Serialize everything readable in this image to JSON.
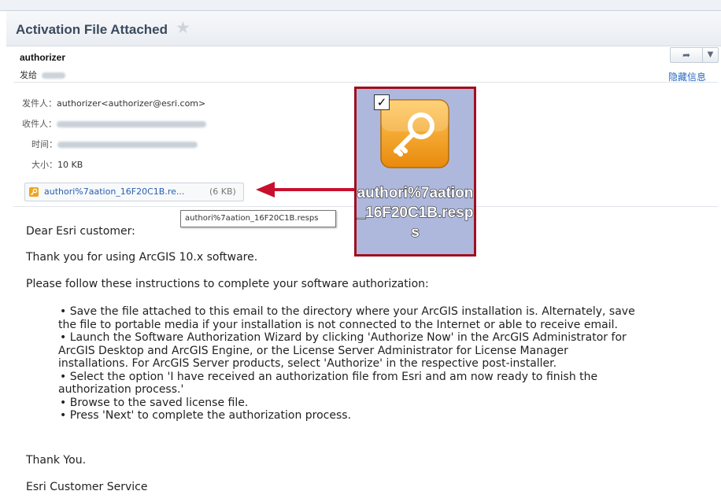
{
  "email": {
    "subject": "Activation File Attached",
    "sender_name": "authorizer",
    "to_label": "发给",
    "hide_details_label": "隐藏信息",
    "details": {
      "from_label": "发件人：",
      "from_value": "authorizer<authorizer@esri.com>",
      "to_label": "收件人：",
      "time_label": "时间：",
      "size_label": "大小：",
      "size_value": "10 KB"
    },
    "attachment": {
      "filename": "authori%7aation_16F20C1B.re...",
      "size": "(6 KB)",
      "tooltip": "authori%7aation_16F20C1B.resps"
    },
    "callout_caption": "authori%7aation_16F20C1B.resps",
    "body": {
      "greeting": "Dear Esri customer:",
      "thanks_line": "Thank you for using ArcGIS 10.x software.",
      "instructions_intro": "Please follow these instructions to complete your software authorization:",
      "bullets": [
        "Save the file attached to this email to the directory where your ArcGIS installation is. Alternately, save",
        "the file to portable media if your installation is not connected to the Internet or able to receive email.",
        "Launch the Software Authorization Wizard by clicking 'Authorize Now' in the ArcGIS Administrator for",
        "ArcGIS Desktop and ArcGIS Engine, or the License Server Administrator for License Manager",
        "installations. For ArcGIS Server products, select 'Authorize' in the respective post-installer.",
        "Select the option 'I have received an authorization file from Esri and am now ready to finish the",
        "authorization process.'",
        "Browse to the saved license file.",
        "Press 'Next' to complete the authorization process."
      ],
      "closing": "Thank You.",
      "signature": "Esri Customer Service"
    }
  },
  "icons": {
    "star": "star-icon",
    "reply": "reply-icon",
    "more": "chevron-down-icon",
    "file": "key-file-icon",
    "arrow": "arrow-left-icon",
    "check": "checkmark-icon"
  },
  "colors": {
    "accent_link": "#2a6bbf",
    "callout_border": "#a10f1f",
    "arrow": "#c8102e",
    "icon_orange": "#f0a21c"
  }
}
